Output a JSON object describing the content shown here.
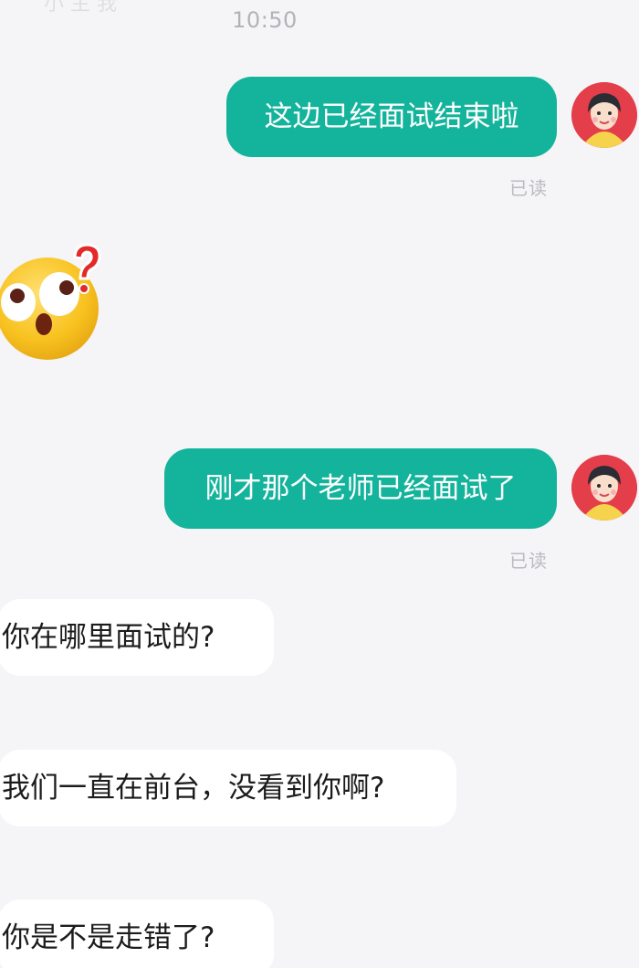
{
  "header": {
    "clipped_text": "小 主 我"
  },
  "conversation": {
    "timestamp": "10:50",
    "messages": [
      {
        "direction": "sent",
        "text": "这边已经面试结束啦",
        "status": "已读",
        "avatar": "female-avatar-icon"
      },
      {
        "direction": "received",
        "type": "sticker",
        "sticker": "confused-emoji-question-icon"
      },
      {
        "direction": "sent",
        "text": "刚才那个老师已经面试了",
        "status": "已读",
        "avatar": "female-avatar-icon"
      },
      {
        "direction": "received",
        "text": "你在哪里面试的?"
      },
      {
        "direction": "received",
        "text": "我们一直在前台，没看到你啊?"
      },
      {
        "direction": "received",
        "text": "你是不是走错了?"
      }
    ]
  },
  "colors": {
    "background": "#f5f4f6",
    "sent_bubble": "#14b39b",
    "received_bubble": "#ffffff",
    "avatar_background": "#e33e4a",
    "emoji_yellow": "#f8c21f",
    "question_mark": "#e22a2a"
  }
}
